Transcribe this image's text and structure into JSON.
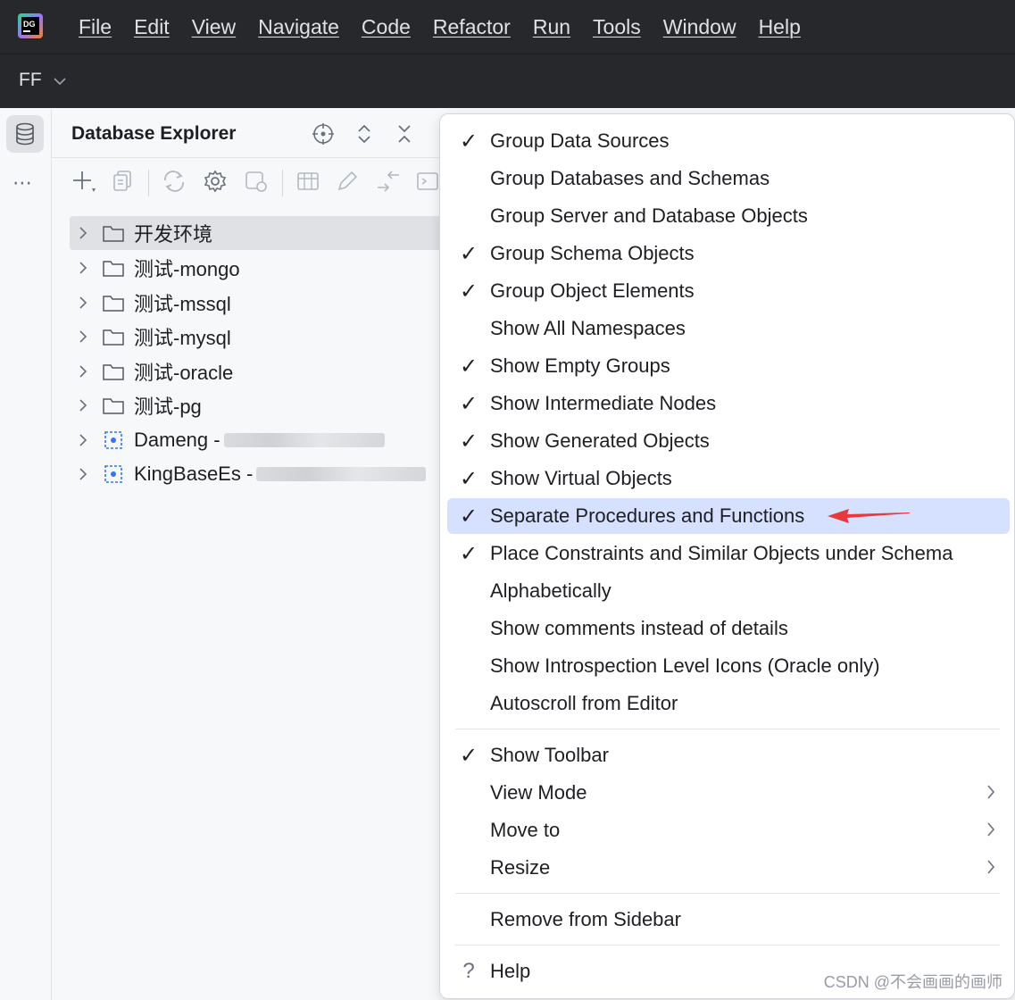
{
  "app": {
    "logo_text": "DG",
    "menu": [
      "File",
      "Edit",
      "View",
      "Navigate",
      "Code",
      "Refactor",
      "Run",
      "Tools",
      "Window",
      "Help"
    ]
  },
  "project": {
    "name": "FF",
    "dropdown_icon": "chevron-down-icon"
  },
  "toolstrip": {
    "active_tool_icon": "database-icon",
    "more_label": "⋯"
  },
  "explorer": {
    "title": "Database Explorer",
    "header_icons": [
      "crosshair-icon",
      "expand-collapse-icon",
      "collapse-all-icon"
    ],
    "toolbar_icons": [
      "add-icon",
      "copy-icon",
      "refresh-icon",
      "settings-icon",
      "disconnect-icon",
      "table-icon",
      "edit-icon",
      "compare-icon",
      "console-icon"
    ],
    "tree": [
      {
        "label": "开发环境",
        "type": "folder",
        "selected": true
      },
      {
        "label": "测试-mongo",
        "type": "folder"
      },
      {
        "label": "测试-mssql",
        "type": "folder"
      },
      {
        "label": "测试-mysql",
        "type": "folder"
      },
      {
        "label": "测试-oracle",
        "type": "folder"
      },
      {
        "label": "测试-pg",
        "type": "folder"
      },
      {
        "label": "Dameng -",
        "type": "datasource",
        "redacted": true
      },
      {
        "label": "KingBaseEs -",
        "type": "datasource",
        "redacted": true
      }
    ]
  },
  "popup_menu": {
    "items": [
      {
        "label": "Group Data Sources",
        "checked": true
      },
      {
        "label": "Group Databases and Schemas",
        "checked": false
      },
      {
        "label": "Group Server and Database Objects",
        "checked": false
      },
      {
        "label": "Group Schema Objects",
        "checked": true
      },
      {
        "label": "Group Object Elements",
        "checked": true
      },
      {
        "label": "Show All Namespaces",
        "checked": false
      },
      {
        "label": "Show Empty Groups",
        "checked": true
      },
      {
        "label": "Show Intermediate Nodes",
        "checked": true
      },
      {
        "label": "Show Generated Objects",
        "checked": true
      },
      {
        "label": "Show Virtual Objects",
        "checked": true
      },
      {
        "label": "Separate Procedures and Functions",
        "checked": true,
        "highlighted": true
      },
      {
        "label": "Place Constraints and Similar Objects under Schema",
        "checked": true
      },
      {
        "label": "Alphabetically",
        "checked": false
      },
      {
        "label": "Show comments instead of details",
        "checked": false
      },
      {
        "label": "Show Introspection Level Icons (Oracle only)",
        "checked": false
      },
      {
        "label": "Autoscroll from Editor",
        "checked": false
      }
    ],
    "group2": [
      {
        "label": "Show Toolbar",
        "checked": true,
        "submenu": false
      },
      {
        "label": "View Mode",
        "checked": false,
        "submenu": true
      },
      {
        "label": "Move to",
        "checked": false,
        "submenu": true
      },
      {
        "label": "Resize",
        "checked": false,
        "submenu": true
      }
    ],
    "remove_label": "Remove from Sidebar",
    "help_label": "Help",
    "help_icon_glyph": "?"
  },
  "annotation": {
    "arrow_color": "#e8383d"
  },
  "watermark": "CSDN @不会画画的画师"
}
